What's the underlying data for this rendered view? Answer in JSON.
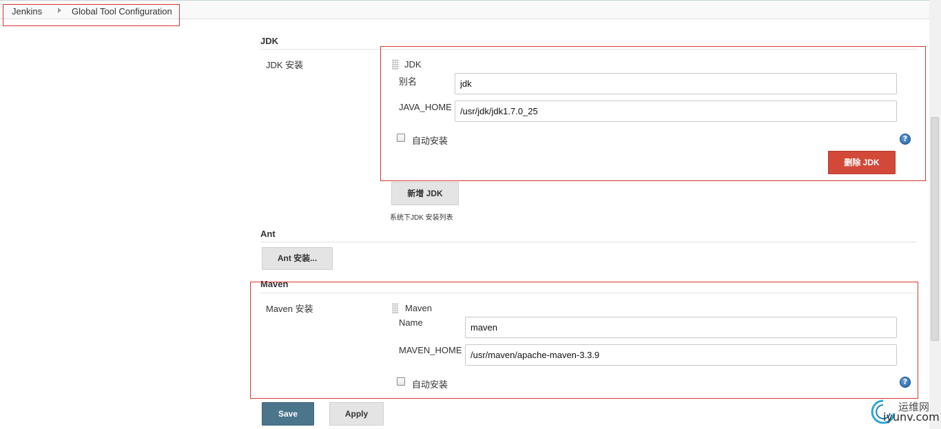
{
  "breadcrumb": {
    "home": "Jenkins",
    "current": "Global Tool Configuration"
  },
  "jdk": {
    "section_title": "JDK",
    "installations_label": "JDK 安装",
    "item_title": "JDK",
    "name_label": "别名",
    "name_value": "jdk",
    "home_label": "JAVA_HOME",
    "home_value": "/usr/jdk/jdk1.7.0_25",
    "auto_install_label": "自动安装",
    "delete_button": "删除 JDK",
    "add_button": "新增 JDK",
    "hint": "系统下JDK 安装列表"
  },
  "ant": {
    "section_title": "Ant",
    "install_button": "Ant 安装..."
  },
  "maven": {
    "section_title": "Maven",
    "installations_label": "Maven 安装",
    "item_title": "Maven",
    "name_label": "Name",
    "name_value": "maven",
    "home_label": "MAVEN_HOME",
    "home_value": "/usr/maven/apache-maven-3.3.9",
    "auto_install_label": "自动安装"
  },
  "footer": {
    "save_label": "Save",
    "apply_label": "Apply"
  },
  "help_glyph": "?",
  "watermark": {
    "cn": "运维网",
    "en": "iyunv.com"
  },
  "colors": {
    "annotation_red": "#d9342f",
    "danger": "#d24939",
    "primary": "#4b758b"
  },
  "icons": [
    "chevron-right-icon",
    "drag-handle-icon",
    "help-icon",
    "checkbox-icon"
  ]
}
